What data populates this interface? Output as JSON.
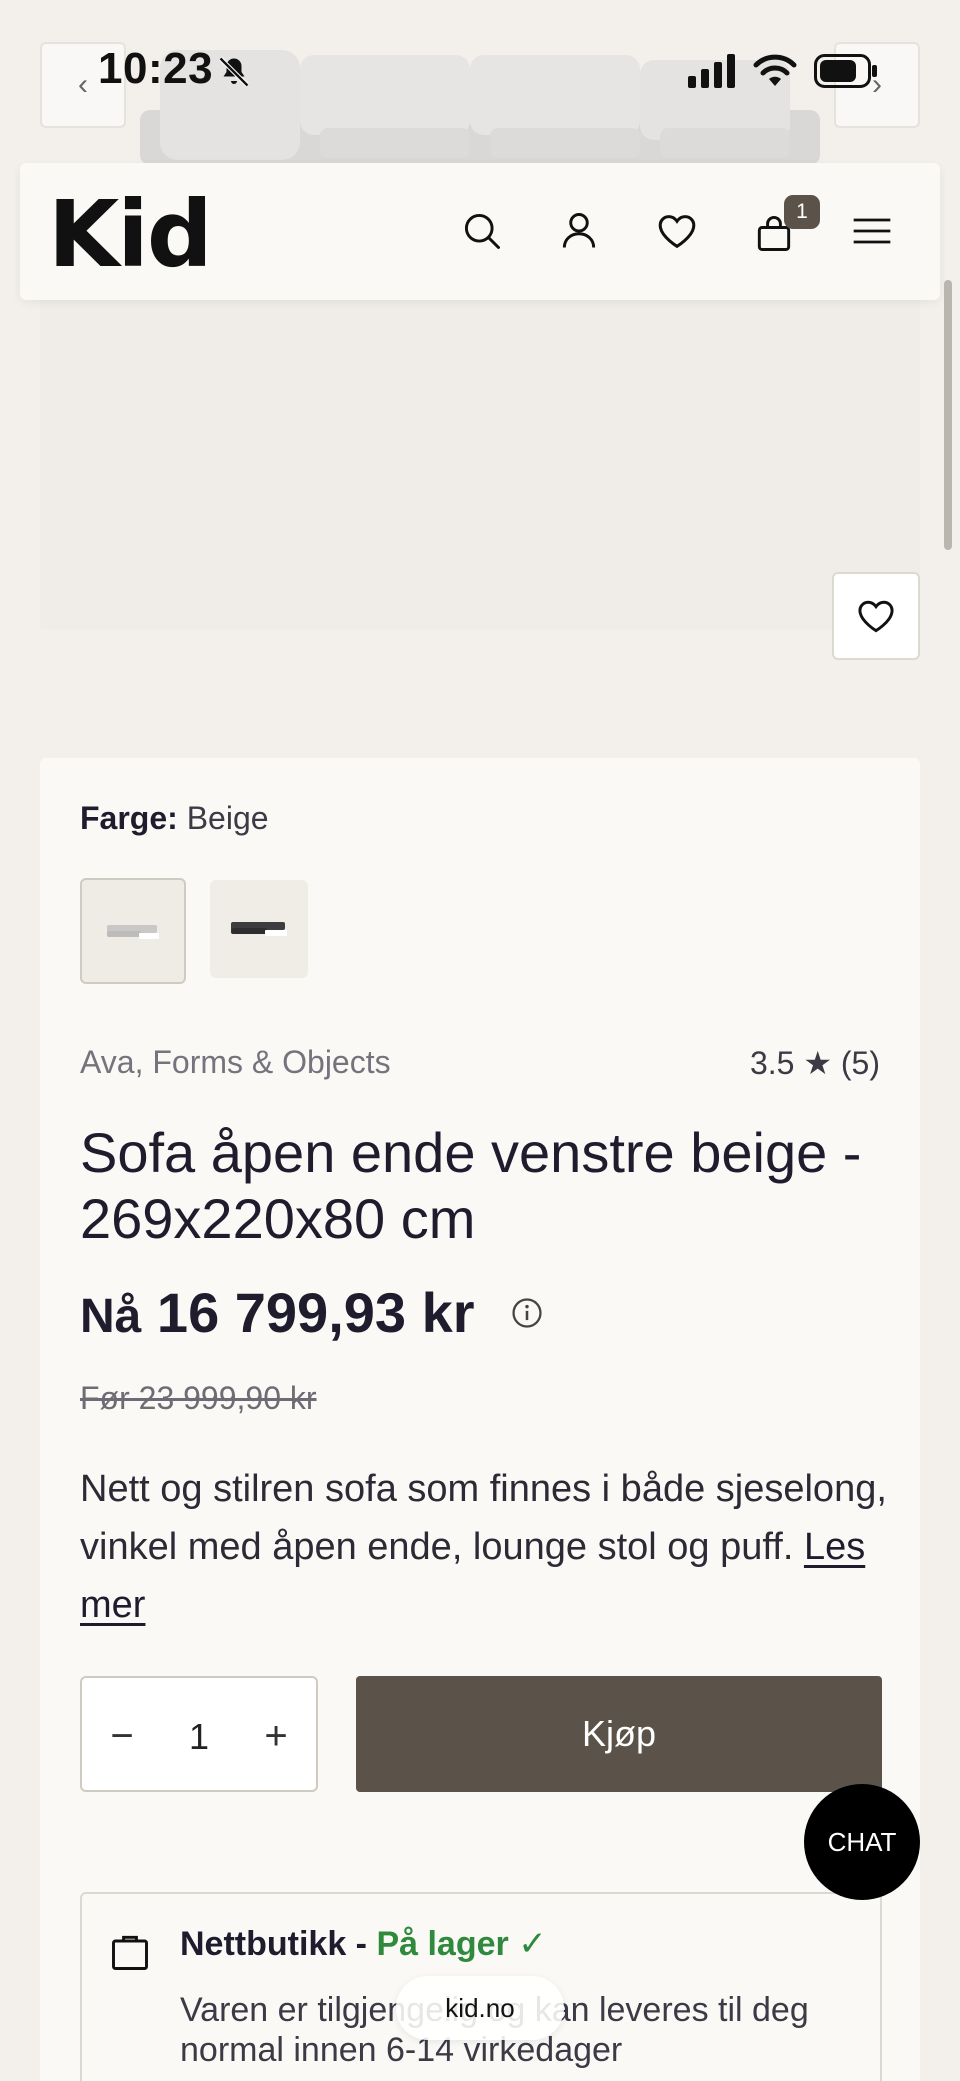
{
  "status_bar": {
    "time": "10:23"
  },
  "header": {
    "logo": "Kid",
    "cart_count": "1",
    "icons": [
      "search-icon",
      "user-icon",
      "heart-icon",
      "bag-icon",
      "menu-icon"
    ]
  },
  "gallery": {
    "prev": "‹",
    "next": "›"
  },
  "product": {
    "color_label": "Farge:",
    "color_value": "Beige",
    "brand": "Ava, Forms & Objects",
    "rating": "3.5",
    "rating_count": "(5)",
    "title": "Sofa åpen ende venstre beige - 269x220x80 cm",
    "price_prefix": "Nå",
    "price_now": "16 799,93 kr",
    "price_before": "Før 23 999,90 kr",
    "description": "Nett og stilren sofa som finnes i både sjeselong, vinkel med åpen ende, lounge stol og puff.",
    "read_more": "Les mer",
    "quantity": "1",
    "qty_minus": "−",
    "qty_plus": "+",
    "buy_label": "Kjøp"
  },
  "stock": {
    "channel": "Nettbutikk -",
    "status": "På lager ✓",
    "text": "Varen er tilgjengelig og kan leveres til deg normal innen 6-14 virkedager"
  },
  "chat_label": "CHAT",
  "browser": {
    "url": "kid.no"
  },
  "colors": {
    "buy_button": "#5b5349",
    "in_stock": "#2f8a3e",
    "page_bg": "#f3f0eb",
    "card_bg": "#faf9f6"
  }
}
